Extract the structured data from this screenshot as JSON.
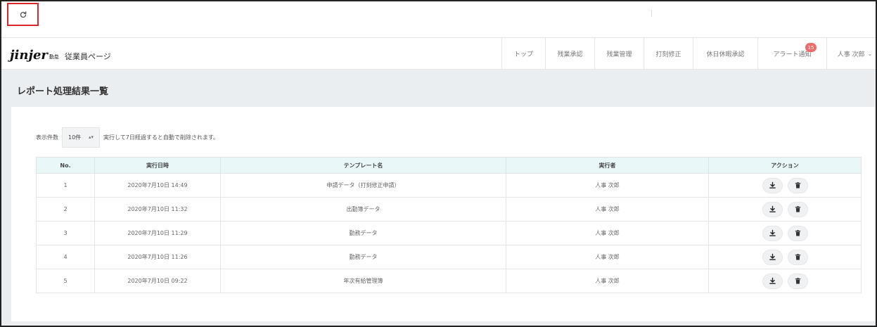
{
  "app": {
    "logo_word": "jinjer",
    "logo_sub": "勤怠",
    "page_name": "従業員ページ"
  },
  "nav": {
    "items": [
      {
        "label": "トップ"
      },
      {
        "label": "残業承認"
      },
      {
        "label": "残業管理"
      },
      {
        "label": "打刻修正"
      },
      {
        "label": "休日休暇承認"
      },
      {
        "label": "アラート通知",
        "badge": "15"
      }
    ],
    "user": "人事 次郎"
  },
  "page": {
    "title": "レポート処理結果一覧"
  },
  "controls": {
    "count_label": "表示件数",
    "count_value": "10件",
    "note": "実行して7日経過すると自動で削除されます。"
  },
  "table": {
    "headers": {
      "no": "No.",
      "executed_at": "実行日時",
      "template": "テンプレート名",
      "executor": "実行者",
      "action": "アクション"
    },
    "rows": [
      {
        "no": "1",
        "executed_at": "2020年7月10日 14:49",
        "template": "申請データ（打刻修正申請）",
        "executor": "人事 次郎"
      },
      {
        "no": "2",
        "executed_at": "2020年7月10日 11:32",
        "template": "出勤簿データ",
        "executor": "人事 次郎"
      },
      {
        "no": "3",
        "executed_at": "2020年7月10日 11:29",
        "template": "勤務データ",
        "executor": "人事 次郎"
      },
      {
        "no": "4",
        "executed_at": "2020年7月10日 11:26",
        "template": "勤務データ",
        "executor": "人事 次郎"
      },
      {
        "no": "5",
        "executed_at": "2020年7月10日 09:22",
        "template": "年次有給管理簿",
        "executor": "人事 次郎"
      }
    ]
  },
  "icons": {
    "reload": "reload-icon",
    "download": "download-icon",
    "delete": "trash-icon"
  },
  "colors": {
    "highlight": "#d9262b",
    "badge": "#f06a6a",
    "header_row": "#e9f7f8",
    "band": "#eaeef1"
  }
}
